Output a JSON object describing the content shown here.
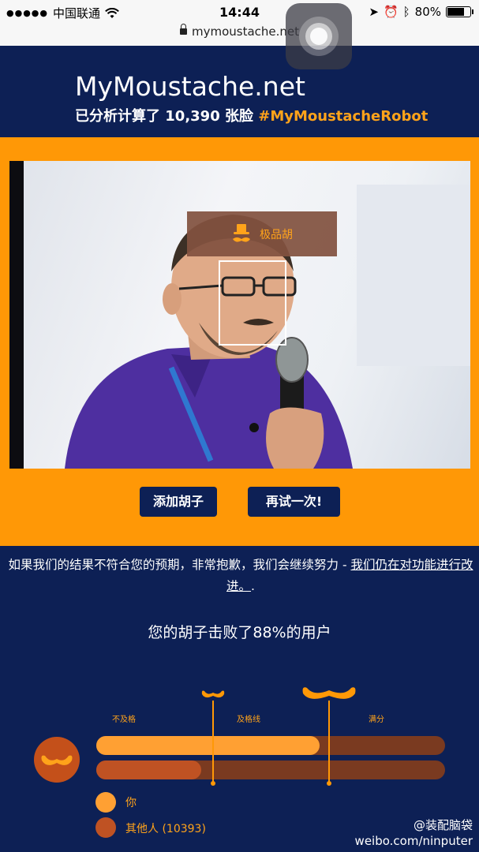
{
  "status_bar": {
    "carrier": "中国联通",
    "time": "14:44",
    "battery": "80%",
    "battery_level": 0.8,
    "url": "mymoustache.net"
  },
  "header": {
    "site_title": "MyMoustache.net",
    "tagline_prefix": "已分析计算了 10,390 张脸 ",
    "tagline_hashtag": "#MyMoustacheRobot"
  },
  "photo_overlay": {
    "rating_label": "极品胡"
  },
  "buttons": {
    "add_moustache": "添加胡子",
    "try_again": "再试一次!"
  },
  "apology": {
    "text": "如果我们的结果不符合您的预期，非常抱歉，我们会继续努力 - ",
    "link": "我们仍在对功能进行改进。",
    "suffix": "."
  },
  "result_text": "您的胡子击败了88%的用户",
  "rating": {
    "levels": [
      "不及格",
      "及格线",
      "满分"
    ],
    "you_fraction": 0.64,
    "others_fraction": 0.3,
    "legend_you": "你",
    "legend_others": "其他人 (10393)"
  },
  "colors": {
    "navy": "#0d2055",
    "orange": "#ff9806",
    "brown": "#7a3a20"
  },
  "watermark": {
    "line1": "@装配脑袋",
    "line2": "weibo.com/ninputer"
  }
}
